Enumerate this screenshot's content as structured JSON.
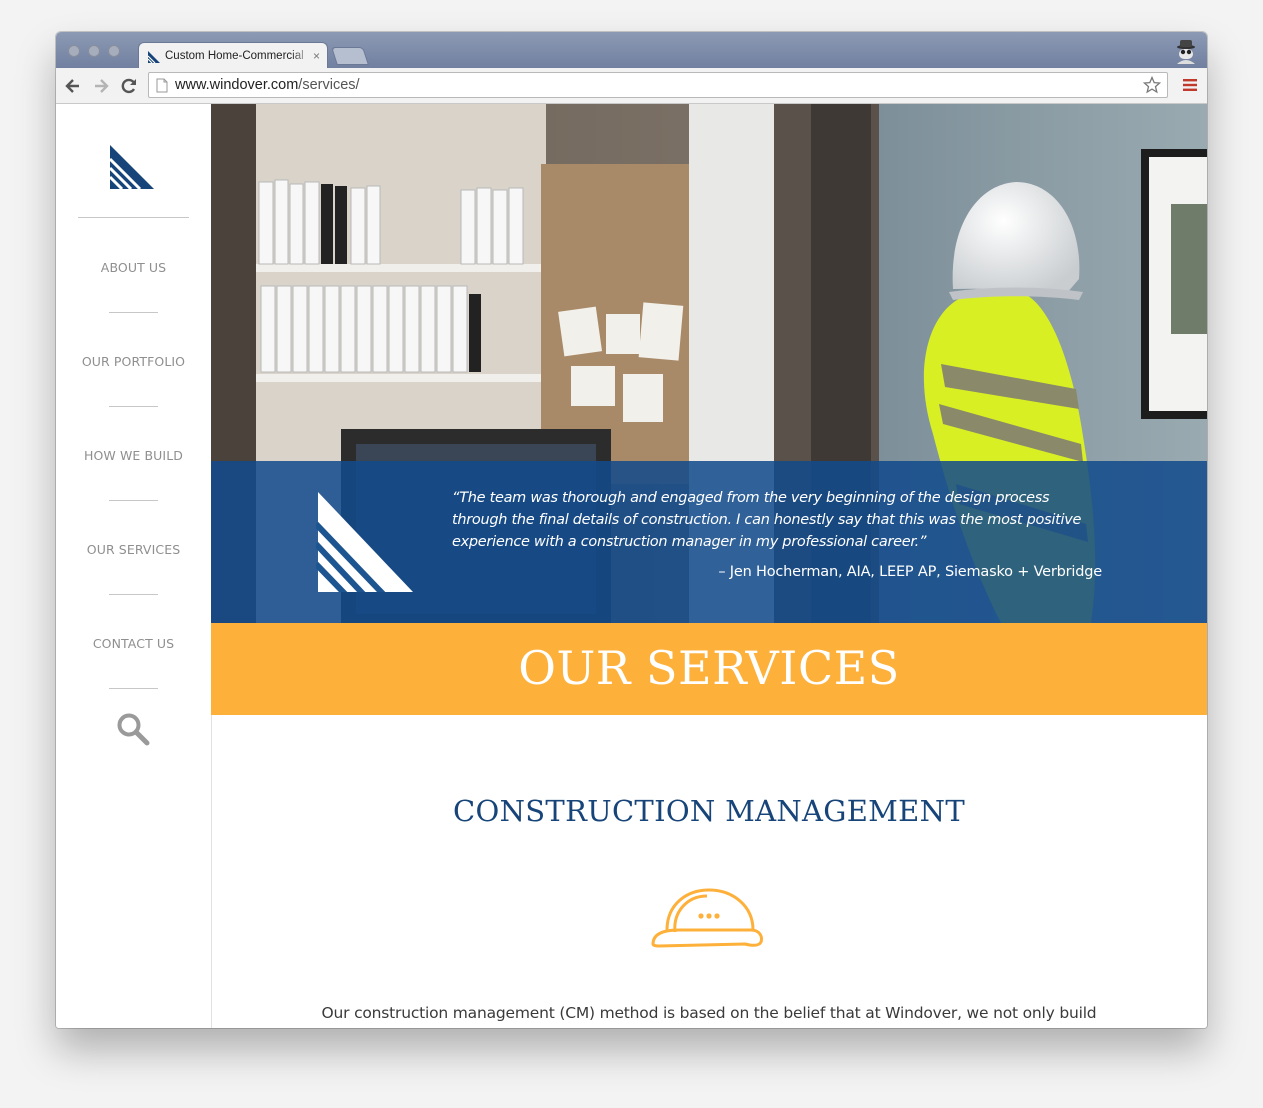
{
  "browser": {
    "tab_title": "Custom Home-Commercial",
    "tab_close": "×",
    "url_domain": "www.windover.com",
    "url_path": "/services/",
    "icons": [
      "back-arrow-icon",
      "forward-arrow-icon",
      "reload-icon",
      "page-icon",
      "bookmark-star-icon",
      "chrome-menu-icon",
      "incognito-icon"
    ]
  },
  "sidebar": {
    "logo": "windover-logo",
    "items": [
      {
        "label": "ABOUT US"
      },
      {
        "label": "OUR PORTFOLIO"
      },
      {
        "label": "HOW WE BUILD"
      },
      {
        "label": "OUR SERVICES"
      },
      {
        "label": "CONTACT US"
      }
    ],
    "search_icon": "search-icon"
  },
  "hero": {
    "quote": "“The team was thorough and engaged from the very beginning of the design process through the final details of construction. I can honestly say that this was the most positive experience with a construction manager in my professional career.”",
    "attribution": "– Jen Hocherman, AIA, LEEP AP, Siemasko + Verbridge"
  },
  "services": {
    "banner_title": "OUR SERVICES",
    "section_title": "CONSTRUCTION MANAGEMENT",
    "section_icon": "hard-hat-icon",
    "intro": "Our construction management (CM) method is based on the belief that at Windover, we not only build"
  },
  "colors": {
    "brand_blue": "#174479",
    "quote_band": "#124a8c",
    "banner_orange": "#fdb03a",
    "nav_text": "#8f8f8f"
  }
}
